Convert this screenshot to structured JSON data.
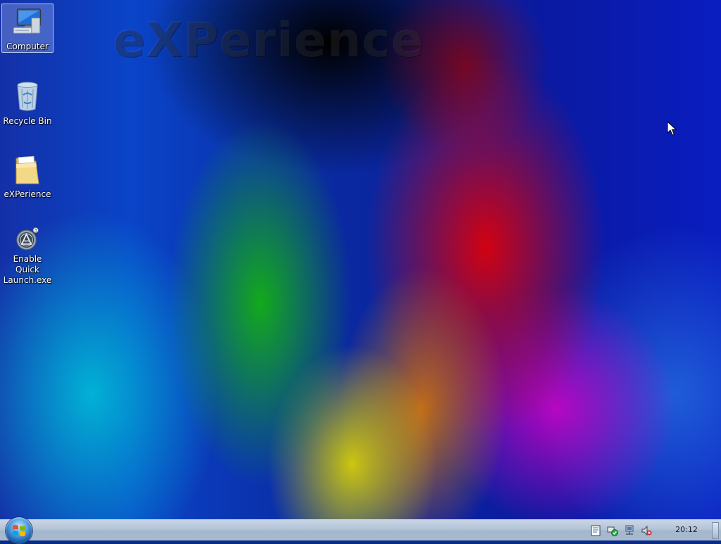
{
  "wallpaper": {
    "logo_text": "eXPerience"
  },
  "desktop": {
    "icons": [
      {
        "label": "Computer",
        "icon": "computer-icon"
      },
      {
        "label": "Recycle Bin",
        "icon": "recycle-bin-icon"
      },
      {
        "label": "eXPerience",
        "icon": "folder-icon"
      },
      {
        "label": "Enable Quick\nLaunch.exe",
        "icon": "app-icon"
      }
    ],
    "selected_icon": "Computer"
  },
  "taskbar": {
    "start_button": "start-orb-icon",
    "tray_icons": [
      "notes-icon",
      "security-shield-icon",
      "network-icon",
      "volume-muted-icon"
    ],
    "clock": "20:12"
  },
  "colors": {
    "taskbar": "#b0c2d6",
    "icon_label": "#ffffff",
    "selection_highlight": "#c8dcff"
  }
}
